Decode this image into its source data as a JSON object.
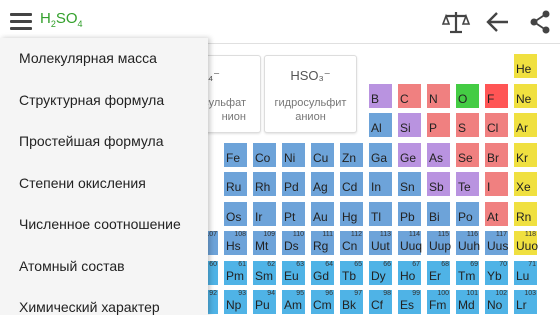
{
  "appbar": {
    "formula_parts": [
      {
        "t": "H",
        "sub": false
      },
      {
        "t": "2",
        "sub": true
      },
      {
        "t": "SO",
        "sub": false
      },
      {
        "t": "4",
        "sub": true
      }
    ],
    "icons": [
      "menu-icon",
      "balance-scale-icon",
      "back-arrow-icon",
      "share-icon"
    ]
  },
  "cards": [
    {
      "formula": "O₄⁻",
      "name": "сульфат\nнион"
    },
    {
      "formula": "HSO₃⁻",
      "name": "гидросульфит\nанион"
    }
  ],
  "colors": {
    "metal": "#6da3d9",
    "alkaline": "#4fb3e6",
    "post_transition": "#6da3d9",
    "metalloid": "#b993e0",
    "nonmetal_red": "#f08080",
    "noble": "#f0e040",
    "oxygen": "#44cc44",
    "fluorine": "#ff5555",
    "formula_green": "#33a02c"
  },
  "elements": [
    {
      "s": "He",
      "n": "",
      "c": "noble",
      "col": 17,
      "row": 0
    },
    {
      "s": "B",
      "n": "",
      "c": "metalloid",
      "col": 12,
      "row": 1
    },
    {
      "s": "C",
      "n": "",
      "c": "nonmetal_red",
      "col": 13,
      "row": 1
    },
    {
      "s": "N",
      "n": "",
      "c": "nonmetal_red",
      "col": 14,
      "row": 1
    },
    {
      "s": "O",
      "n": "",
      "c": "oxygen",
      "col": 15,
      "row": 1
    },
    {
      "s": "F",
      "n": "",
      "c": "fluorine",
      "col": 16,
      "row": 1
    },
    {
      "s": "Ne",
      "n": "",
      "c": "noble",
      "col": 17,
      "row": 1
    },
    {
      "s": "Al",
      "n": "",
      "c": "post_transition",
      "col": 12,
      "row": 2
    },
    {
      "s": "Si",
      "n": "",
      "c": "metalloid",
      "col": 13,
      "row": 2
    },
    {
      "s": "P",
      "n": "",
      "c": "nonmetal_red",
      "col": 14,
      "row": 2
    },
    {
      "s": "S",
      "n": "",
      "c": "nonmetal_red",
      "col": 15,
      "row": 2
    },
    {
      "s": "Cl",
      "n": "",
      "c": "nonmetal_red",
      "col": 16,
      "row": 2
    },
    {
      "s": "Ar",
      "n": "",
      "c": "noble",
      "col": 17,
      "row": 2
    },
    {
      "s": "Fe",
      "n": "",
      "c": "metal",
      "col": 7,
      "row": 3
    },
    {
      "s": "Co",
      "n": "",
      "c": "metal",
      "col": 8,
      "row": 3
    },
    {
      "s": "Ni",
      "n": "",
      "c": "metal",
      "col": 9,
      "row": 3
    },
    {
      "s": "Cu",
      "n": "",
      "c": "metal",
      "col": 10,
      "row": 3
    },
    {
      "s": "Zn",
      "n": "",
      "c": "metal",
      "col": 11,
      "row": 3
    },
    {
      "s": "Ga",
      "n": "",
      "c": "post_transition",
      "col": 12,
      "row": 3
    },
    {
      "s": "Ge",
      "n": "",
      "c": "metalloid",
      "col": 13,
      "row": 3
    },
    {
      "s": "As",
      "n": "",
      "c": "metalloid",
      "col": 14,
      "row": 3
    },
    {
      "s": "Se",
      "n": "",
      "c": "nonmetal_red",
      "col": 15,
      "row": 3
    },
    {
      "s": "Br",
      "n": "",
      "c": "nonmetal_red",
      "col": 16,
      "row": 3
    },
    {
      "s": "Kr",
      "n": "",
      "c": "noble",
      "col": 17,
      "row": 3
    },
    {
      "s": "Ru",
      "n": "",
      "c": "metal",
      "col": 7,
      "row": 4
    },
    {
      "s": "Rh",
      "n": "",
      "c": "metal",
      "col": 8,
      "row": 4
    },
    {
      "s": "Pd",
      "n": "",
      "c": "metal",
      "col": 9,
      "row": 4
    },
    {
      "s": "Ag",
      "n": "",
      "c": "metal",
      "col": 10,
      "row": 4
    },
    {
      "s": "Cd",
      "n": "",
      "c": "metal",
      "col": 11,
      "row": 4
    },
    {
      "s": "In",
      "n": "",
      "c": "post_transition",
      "col": 12,
      "row": 4
    },
    {
      "s": "Sn",
      "n": "",
      "c": "post_transition",
      "col": 13,
      "row": 4
    },
    {
      "s": "Sb",
      "n": "",
      "c": "metalloid",
      "col": 14,
      "row": 4
    },
    {
      "s": "Te",
      "n": "",
      "c": "metalloid",
      "col": 15,
      "row": 4
    },
    {
      "s": "I",
      "n": "",
      "c": "nonmetal_red",
      "col": 16,
      "row": 4
    },
    {
      "s": "Xe",
      "n": "",
      "c": "noble",
      "col": 17,
      "row": 4
    },
    {
      "s": "Os",
      "n": "",
      "c": "metal",
      "col": 7,
      "row": 5
    },
    {
      "s": "Ir",
      "n": "",
      "c": "metal",
      "col": 8,
      "row": 5
    },
    {
      "s": "Pt",
      "n": "",
      "c": "metal",
      "col": 9,
      "row": 5
    },
    {
      "s": "Au",
      "n": "",
      "c": "metal",
      "col": 10,
      "row": 5
    },
    {
      "s": "Hg",
      "n": "",
      "c": "metal",
      "col": 11,
      "row": 5
    },
    {
      "s": "Tl",
      "n": "",
      "c": "post_transition",
      "col": 12,
      "row": 5
    },
    {
      "s": "Pb",
      "n": "",
      "c": "post_transition",
      "col": 13,
      "row": 5
    },
    {
      "s": "Bi",
      "n": "",
      "c": "post_transition",
      "col": 14,
      "row": 5
    },
    {
      "s": "Po",
      "n": "",
      "c": "post_transition",
      "col": 15,
      "row": 5
    },
    {
      "s": "At",
      "n": "",
      "c": "nonmetal_red",
      "col": 16,
      "row": 5
    },
    {
      "s": "Rn",
      "n": "",
      "c": "noble",
      "col": 17,
      "row": 5
    },
    {
      "s": "",
      "n": "107",
      "c": "metal",
      "col": 6,
      "row": 6
    },
    {
      "s": "Hs",
      "n": "108",
      "c": "metal",
      "col": 7,
      "row": 6
    },
    {
      "s": "Mt",
      "n": "109",
      "c": "metal",
      "col": 8,
      "row": 6
    },
    {
      "s": "Ds",
      "n": "110",
      "c": "metal",
      "col": 9,
      "row": 6
    },
    {
      "s": "Rg",
      "n": "111",
      "c": "metal",
      "col": 10,
      "row": 6
    },
    {
      "s": "Cn",
      "n": "112",
      "c": "metal",
      "col": 11,
      "row": 6
    },
    {
      "s": "Uut",
      "n": "113",
      "c": "post_transition",
      "col": 12,
      "row": 6
    },
    {
      "s": "Uuq",
      "n": "114",
      "c": "post_transition",
      "col": 13,
      "row": 6
    },
    {
      "s": "Uup",
      "n": "115",
      "c": "post_transition",
      "col": 14,
      "row": 6
    },
    {
      "s": "Uuh",
      "n": "116",
      "c": "post_transition",
      "col": 15,
      "row": 6
    },
    {
      "s": "Uus",
      "n": "117",
      "c": "post_transition",
      "col": 16,
      "row": 6
    },
    {
      "s": "Uuo",
      "n": "118",
      "c": "noble",
      "col": 17,
      "row": 6
    },
    {
      "s": "",
      "n": "60",
      "c": "alkaline",
      "col": 6,
      "row": 7
    },
    {
      "s": "Pm",
      "n": "61",
      "c": "alkaline",
      "col": 7,
      "row": 7
    },
    {
      "s": "Sm",
      "n": "62",
      "c": "alkaline",
      "col": 8,
      "row": 7
    },
    {
      "s": "Eu",
      "n": "63",
      "c": "alkaline",
      "col": 9,
      "row": 7
    },
    {
      "s": "Gd",
      "n": "64",
      "c": "alkaline",
      "col": 10,
      "row": 7
    },
    {
      "s": "Tb",
      "n": "65",
      "c": "alkaline",
      "col": 11,
      "row": 7
    },
    {
      "s": "Dy",
      "n": "66",
      "c": "alkaline",
      "col": 12,
      "row": 7
    },
    {
      "s": "Ho",
      "n": "67",
      "c": "alkaline",
      "col": 13,
      "row": 7
    },
    {
      "s": "Er",
      "n": "68",
      "c": "alkaline",
      "col": 14,
      "row": 7
    },
    {
      "s": "Tm",
      "n": "69",
      "c": "alkaline",
      "col": 15,
      "row": 7
    },
    {
      "s": "Yb",
      "n": "70",
      "c": "alkaline",
      "col": 16,
      "row": 7
    },
    {
      "s": "Lu",
      "n": "71",
      "c": "alkaline",
      "col": 17,
      "row": 7
    },
    {
      "s": "",
      "n": "92",
      "c": "alkaline",
      "col": 6,
      "row": 8
    },
    {
      "s": "Np",
      "n": "93",
      "c": "alkaline",
      "col": 7,
      "row": 8
    },
    {
      "s": "Pu",
      "n": "94",
      "c": "alkaline",
      "col": 8,
      "row": 8
    },
    {
      "s": "Am",
      "n": "95",
      "c": "alkaline",
      "col": 9,
      "row": 8
    },
    {
      "s": "Cm",
      "n": "96",
      "c": "alkaline",
      "col": 10,
      "row": 8
    },
    {
      "s": "Bk",
      "n": "97",
      "c": "alkaline",
      "col": 11,
      "row": 8
    },
    {
      "s": "Cf",
      "n": "98",
      "c": "alkaline",
      "col": 12,
      "row": 8
    },
    {
      "s": "Es",
      "n": "99",
      "c": "alkaline",
      "col": 13,
      "row": 8
    },
    {
      "s": "Fm",
      "n": "100",
      "c": "alkaline",
      "col": 14,
      "row": 8
    },
    {
      "s": "Md",
      "n": "101",
      "c": "alkaline",
      "col": 15,
      "row": 8
    },
    {
      "s": "No",
      "n": "102",
      "c": "alkaline",
      "col": 16,
      "row": 8
    },
    {
      "s": "Lr",
      "n": "103",
      "c": "alkaline",
      "col": 17,
      "row": 8
    }
  ],
  "drawer": {
    "items": [
      "Молекулярная масса",
      "Структурная формула",
      "Простейшая формула",
      "Степени окисления",
      "Численное соотношение",
      "Атомный состав",
      "Химический характер"
    ]
  }
}
